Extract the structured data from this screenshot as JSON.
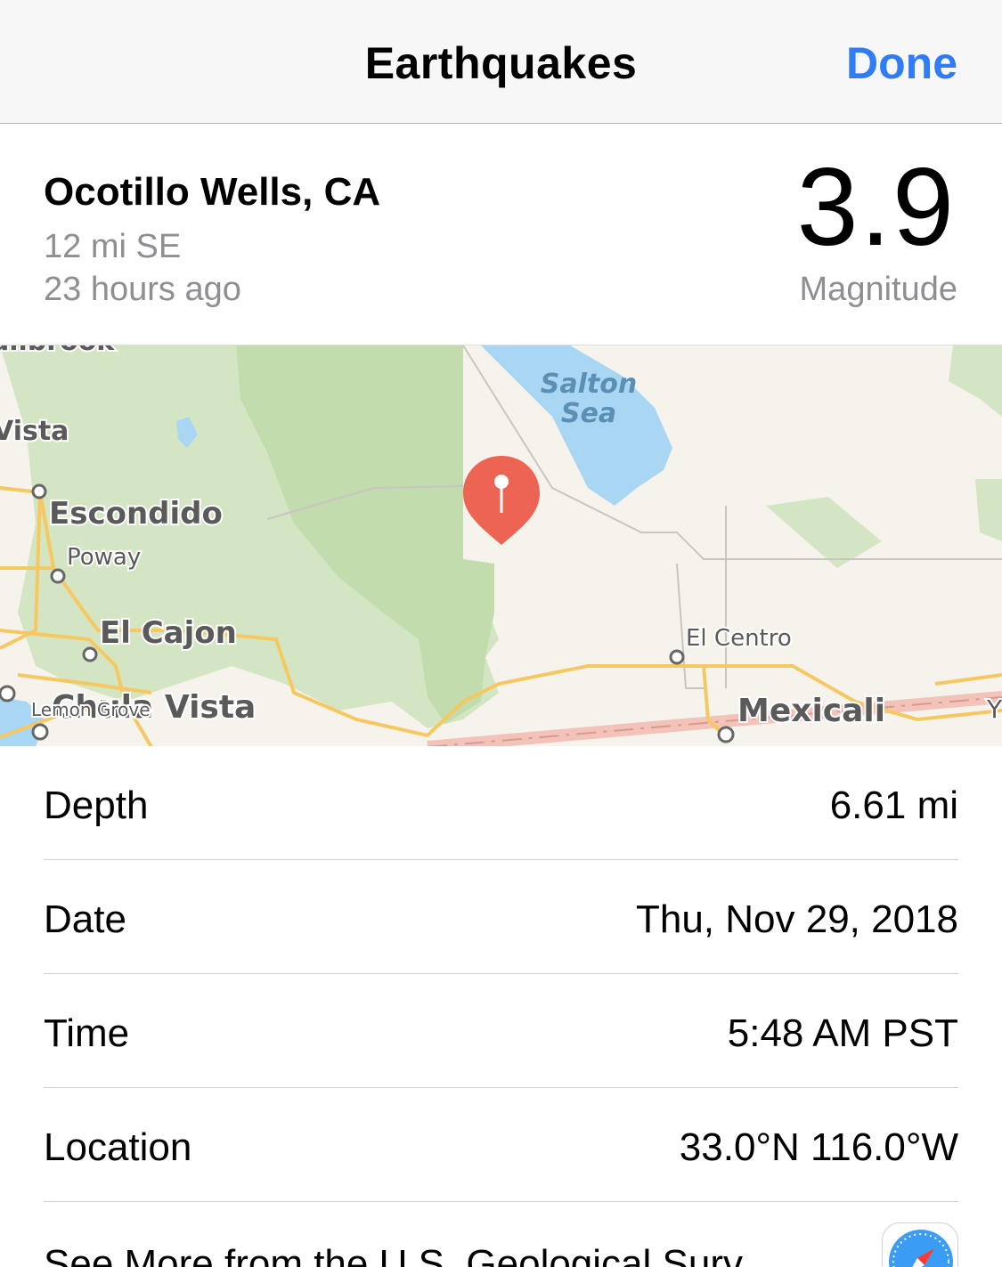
{
  "nav": {
    "title": "Earthquakes",
    "done": "Done"
  },
  "quake": {
    "place": "Ocotillo Wells, CA",
    "distance": "12 mi SE",
    "ago": "23 hours ago",
    "magnitude": "3.9",
    "magnitude_label": "Magnitude"
  },
  "map": {
    "labels": {
      "fallbrook": "allbrook",
      "vista": "Vista",
      "escondido": "Escondido",
      "poway": "Poway",
      "el_cajon": "El Cajon",
      "chula_vista": "Chula Vista",
      "lemon_grove": "Lemon Grove",
      "salton": "Salton",
      "sea": "Sea",
      "el_centro": "El Centro",
      "mexicali": "Mexicali",
      "edge": "Y"
    }
  },
  "details": [
    {
      "label": "Depth",
      "value": "6.61 mi"
    },
    {
      "label": "Date",
      "value": "Thu, Nov 29, 2018"
    },
    {
      "label": "Time",
      "value": "5:48 AM PST"
    },
    {
      "label": "Location",
      "value": "33.0°N 116.0°W"
    }
  ],
  "usgs_link": "See More from the U.S. Geological Surv",
  "colors": {
    "accent": "#2f7cf6",
    "pin": "#ee6452",
    "water": "#a9d6f3",
    "park": "#d3e5c3",
    "road": "#f5c861"
  },
  "icons": {
    "safari": "safari-icon",
    "pin": "map-pin-icon"
  }
}
